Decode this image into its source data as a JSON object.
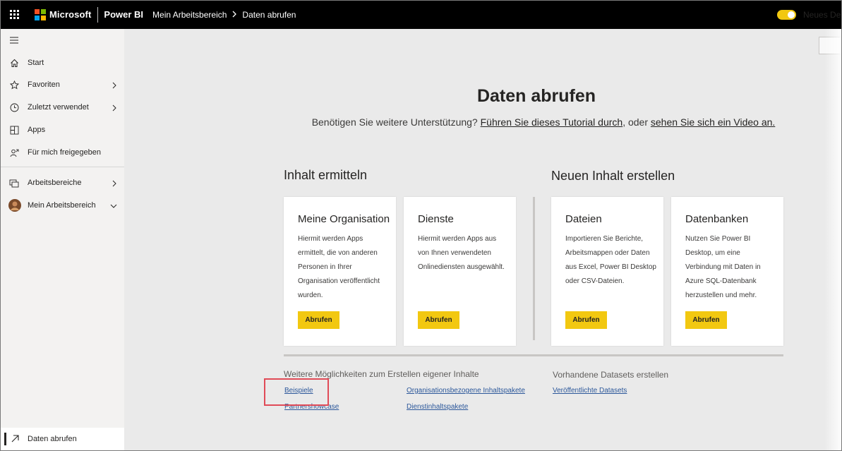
{
  "topbar": {
    "brand": "Microsoft",
    "product": "Power BI",
    "breadcrumb": [
      "Mein Arbeitsbereich",
      "Daten abrufen"
    ],
    "toggle_label": "Neues Design",
    "toggle_on": true,
    "ms_colors": [
      "#f25022",
      "#7fba00",
      "#00a4ef",
      "#ffb900"
    ]
  },
  "sidebar": {
    "items": [
      {
        "label": "Start",
        "icon": "home-icon"
      },
      {
        "label": "Favoriten",
        "icon": "star-icon",
        "chevron": true
      },
      {
        "label": "Zuletzt verwendet",
        "icon": "clock-icon",
        "chevron": true
      },
      {
        "label": "Apps",
        "icon": "apps-icon"
      },
      {
        "label": "Für mich freigegeben",
        "icon": "shared-person-icon"
      },
      {
        "label": "Arbeitsbereiche",
        "icon": "workspaces-icon",
        "chevron": true
      },
      {
        "label": "Mein Arbeitsbereich",
        "icon": "avatar",
        "chevron_down": true
      }
    ],
    "active_item": {
      "label": "Daten abrufen",
      "icon": "arrow-up-right-icon"
    }
  },
  "main": {
    "title": "Daten abrufen",
    "subtitle_prefix": "Benötigen Sie weitere Unterstützung?",
    "subtitle_link1": "Führen Sie dieses Tutorial durch",
    "subtitle_mid": ", oder",
    "subtitle_link2": "sehen Sie sich ein Video an.",
    "discover_heading": "Inhalt ermitteln",
    "create_heading": "Neuen Inhalt erstellen",
    "cards": [
      {
        "title": "Meine Organisation",
        "desc": "Hiermit werden Apps ermittelt, die von anderen Personen in Ihrer Organisation veröffentlicht wurden.",
        "button": "Abrufen"
      },
      {
        "title": "Dienste",
        "desc": "Hiermit werden Apps aus von Ihnen verwendeten Onlinediensten ausgewählt.",
        "button": "Abrufen"
      },
      {
        "title": "Dateien",
        "desc": "Importieren Sie Berichte, Arbeitsmappen oder Daten aus Excel, Power BI Desktop oder CSV-Dateien.",
        "button": "Abrufen"
      },
      {
        "title": "Datenbanken",
        "desc": "Nutzen Sie Power BI Desktop, um eine Verbindung mit Daten in Azure SQL-Datenbank herzustellen und mehr.",
        "button": "Abrufen"
      }
    ],
    "more_heading": "Weitere Möglichkeiten zum Erstellen eigener Inhalte",
    "more_links": [
      "Beispiele",
      "Partnershowcase",
      "Organisationsbezogene Inhaltspakete",
      "Dienstinhaltspakete"
    ],
    "datasets_heading": "Vorhandene Datasets erstellen",
    "datasets_link": "Veröffentlichte Datasets"
  }
}
